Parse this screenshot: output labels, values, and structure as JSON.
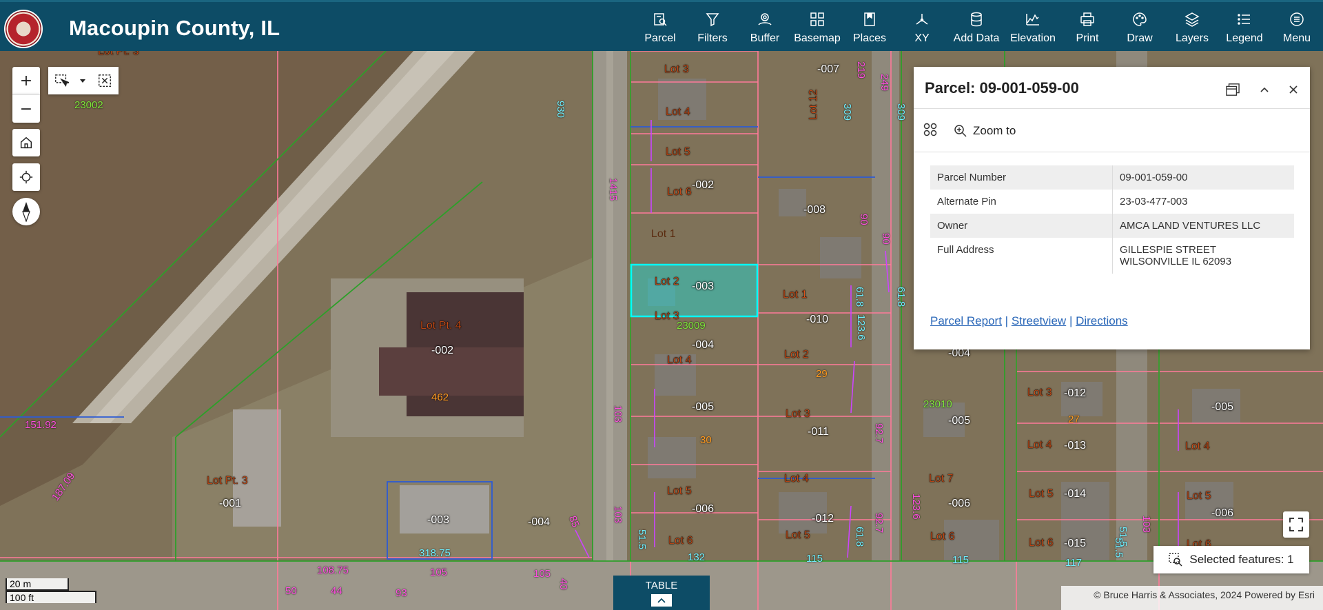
{
  "app": {
    "title": "Macoupin County, IL"
  },
  "toolbar": [
    {
      "label": "Parcel",
      "icon": "parcel-search-icon"
    },
    {
      "label": "Filters",
      "icon": "filter-icon"
    },
    {
      "label": "Buffer",
      "icon": "buffer-icon"
    },
    {
      "label": "Basemap",
      "icon": "basemap-grid-icon"
    },
    {
      "label": "Places",
      "icon": "bookmark-icon"
    },
    {
      "label": "XY",
      "icon": "xy-coordinate-icon"
    },
    {
      "label": "Add Data",
      "icon": "database-icon"
    },
    {
      "label": "Elevation",
      "icon": "elevation-profile-icon"
    },
    {
      "label": "Print",
      "icon": "printer-icon"
    },
    {
      "label": "Draw",
      "icon": "draw-palette-icon"
    },
    {
      "label": "Layers",
      "icon": "layers-icon"
    },
    {
      "label": "Legend",
      "icon": "legend-list-icon"
    },
    {
      "label": "Menu",
      "icon": "menu-icon"
    }
  ],
  "map_controls": {
    "zoom_in": "+",
    "zoom_out": "−"
  },
  "popup": {
    "title": "Parcel: 09-001-059-00",
    "zoom_to": "Zoom to",
    "fields": [
      {
        "key": "Parcel Number",
        "value": "09-001-059-00"
      },
      {
        "key": "Alternate Pin",
        "value": "23-03-477-003"
      },
      {
        "key": "Owner",
        "value": "AMCA LAND VENTURES LLC"
      },
      {
        "key": "Full Address",
        "value": "GILLESPIE STREET WILSONVILLE IL 62093"
      }
    ],
    "links": {
      "parcel_report": "Parcel Report",
      "separator": "|",
      "streetview": "Streetview",
      "directions": "Directions"
    }
  },
  "map_labels": {
    "lots": [
      "Lot Pt. 3",
      "Lot 3",
      "Lot 4",
      "Lot 5",
      "Lot 6",
      "Lot 1",
      "Lot 2",
      "Lot 3",
      "Lot 4",
      "Lot 5",
      "Lot 6",
      "Lot 12",
      "Lot 1",
      "Lot 2",
      "Lot 3",
      "Lot 4",
      "Lot 5",
      "Lot Pt. 4",
      "Lot Pt. 3",
      "Lot 7",
      "Lot 6",
      "Lot 3",
      "Lot 4",
      "Lot 5",
      "Lot 6",
      "Lot 4",
      "Lot 5",
      "Lot 6"
    ],
    "pins": [
      "-007",
      "-002",
      "-008",
      "-003",
      "-010",
      "-004",
      "-002",
      "-005",
      "-011",
      "-004",
      "-005",
      "-006",
      "-012",
      "-006",
      "-001",
      "-003",
      "-004",
      "-012",
      "-013",
      "-014",
      "-015",
      "-005",
      "-006"
    ],
    "dims": [
      "930",
      "1415",
      "219",
      "249",
      "309",
      "309",
      "90",
      "90",
      "61.8",
      "61.8",
      "123.6",
      "92.7",
      "92.7",
      "123.6",
      "61.8",
      "103",
      "103",
      "51.5",
      "51.5",
      "103",
      "187.09",
      "151.92",
      "108.75",
      "85",
      "50",
      "44",
      "93",
      "105",
      "105",
      "40"
    ],
    "dims_cyan": [
      "318.75",
      "132",
      "115",
      "115",
      "117",
      "51.5"
    ],
    "green": [
      "23002",
      "23009",
      "23010"
    ],
    "orange": [
      "29",
      "30",
      "27",
      "462"
    ]
  },
  "table_tab": "TABLE",
  "attribution": "© Bruce Harris & Associates, 2024   Powered by Esri",
  "selected_features": "Selected features: 1",
  "scalebar": {
    "metric": "20 m",
    "imperial": "100 ft"
  }
}
